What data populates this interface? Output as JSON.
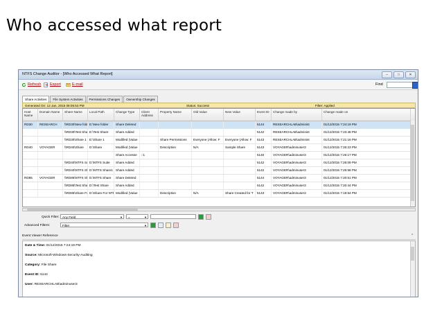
{
  "slide": {
    "title": "Who accessed what report"
  },
  "window": {
    "title": "NTFS Change Auditor - [Who Accessed What Report]",
    "controls": [
      "–",
      "□",
      "✕"
    ]
  },
  "toolbar": {
    "refresh": "Refresh",
    "export": "Export",
    "email": "E-mail",
    "find_label": "Find"
  },
  "tabs": [
    "Share Activities",
    "File System Activities",
    "Permissions Changes",
    "Ownership Changes"
  ],
  "status": {
    "generated": "Generated On: 12 Jan. 2015 08:05:53 PM",
    "status": "Status: Success",
    "filter": "Filter: Applied"
  },
  "columns": [
    "Host Name",
    "Domain Name",
    "Share Name",
    "Local Path",
    "Change Type",
    "Client Address",
    "Property Name",
    "Old Value",
    "New Value",
    "Event ID",
    "Change made by",
    "Change made on"
  ],
  "rows": [
    [
      "RD30",
      "RESEARCH",
      "\\\\RD30\\New folder",
      "E:\\New folder",
      "Share Deleted",
      "",
      "",
      "",
      "",
      "5144",
      "RESEARCHLAB\\administ",
      "01/12/2015 7:24:19 PM"
    ],
    [
      "",
      "",
      "\\\\RD30\\Test Share2",
      "E:\\Test Share",
      "Share Added",
      "",
      "",
      "",
      "",
      "5142",
      "RESEARCHLAB\\administ",
      "01/12/2015 7:23:48 PM"
    ],
    [
      "",
      "",
      "\\\\RD30\\Share 1",
      "E:\\Share 1",
      "Modified (Value",
      "",
      "Share Permissions",
      "Everyone (Allow: F",
      "Everyone (Allow: F",
      "5143",
      "RESEARCHLAB\\administ",
      "01/12/2015 7:21:16 PM"
    ],
    [
      "RD40",
      "VOYAGER",
      "\\\\RD40\\Share",
      "D:\\Share",
      "Modified (Value",
      "",
      "Description",
      "N/A",
      "Sample Share",
      "5143",
      "VOYAGER\\adminuser3",
      "01/12/2015 7:26:23 PM"
    ],
    [
      "",
      "",
      "",
      "",
      "Share Accesse",
      "::1",
      "",
      "",
      "",
      "5140",
      "VOYAGER\\adminuser3",
      "01/12/2015 7:26:17 PM"
    ],
    [
      "",
      "",
      "\\\\RD40\\NTFS Suite",
      "D:\\NTFS Suite",
      "Share Added",
      "",
      "",
      "",
      "",
      "5142",
      "VOYAGER\\adminuser3",
      "01/12/2015 7:26:09 PM"
    ],
    [
      "",
      "",
      "\\\\RD40\\NTFS Share",
      "D:\\NTFS Share1",
      "Share Added",
      "",
      "",
      "",
      "",
      "5142",
      "VOYAGER\\adminuser3",
      "01/12/2015 7:25:58 PM"
    ],
    [
      "RD85",
      "VOYAGER",
      "\\\\RD85\\NTFS Share",
      "D:\\NTFS Share",
      "Share Deleted",
      "",
      "",
      "",
      "",
      "5144",
      "VOYAGER\\adminuser3",
      "01/12/2015 7:20:51 PM"
    ],
    [
      "",
      "",
      "\\\\RD85\\Test Share",
      "D:\\Test Share",
      "Share Added",
      "",
      "",
      "",
      "",
      "5142",
      "VOYAGER\\adminuser3",
      "01/12/2015 7:20:44 PM"
    ],
    [
      "",
      "",
      "\\\\RD85\\Share For N",
      "D:\\Share For NTF",
      "Modified (Value",
      "",
      "Description",
      "N/A",
      "Share Created for T",
      "5143",
      "VOYAGER\\adminuser3",
      "01/12/2015 7:19:54 PM"
    ]
  ],
  "quick_filter": {
    "label": "Quick Filter:",
    "field": "Any Field",
    "operator": "="
  },
  "advanced_filter": {
    "label": "Advanced Filters:",
    "value": "Filter"
  },
  "event_viewer": {
    "title": "Event Viewer Reference",
    "lines": [
      {
        "k": "Date & Time:",
        "v": "01/12/2015 7:24:19 PM"
      },
      {
        "k": "Source:",
        "v": "Microsoft-Windows-Security-Auditing"
      },
      {
        "k": "Category:",
        "v": "File Share"
      },
      {
        "k": "Event ID:",
        "v": "5144"
      },
      {
        "k": "User:",
        "v": "RESEARCHLAB\\adminuser3"
      }
    ]
  },
  "colors": {
    "status_bar": "#f4e7a9",
    "selected_row": "#cfe3f7",
    "titlebar": "#c6d6ea"
  }
}
